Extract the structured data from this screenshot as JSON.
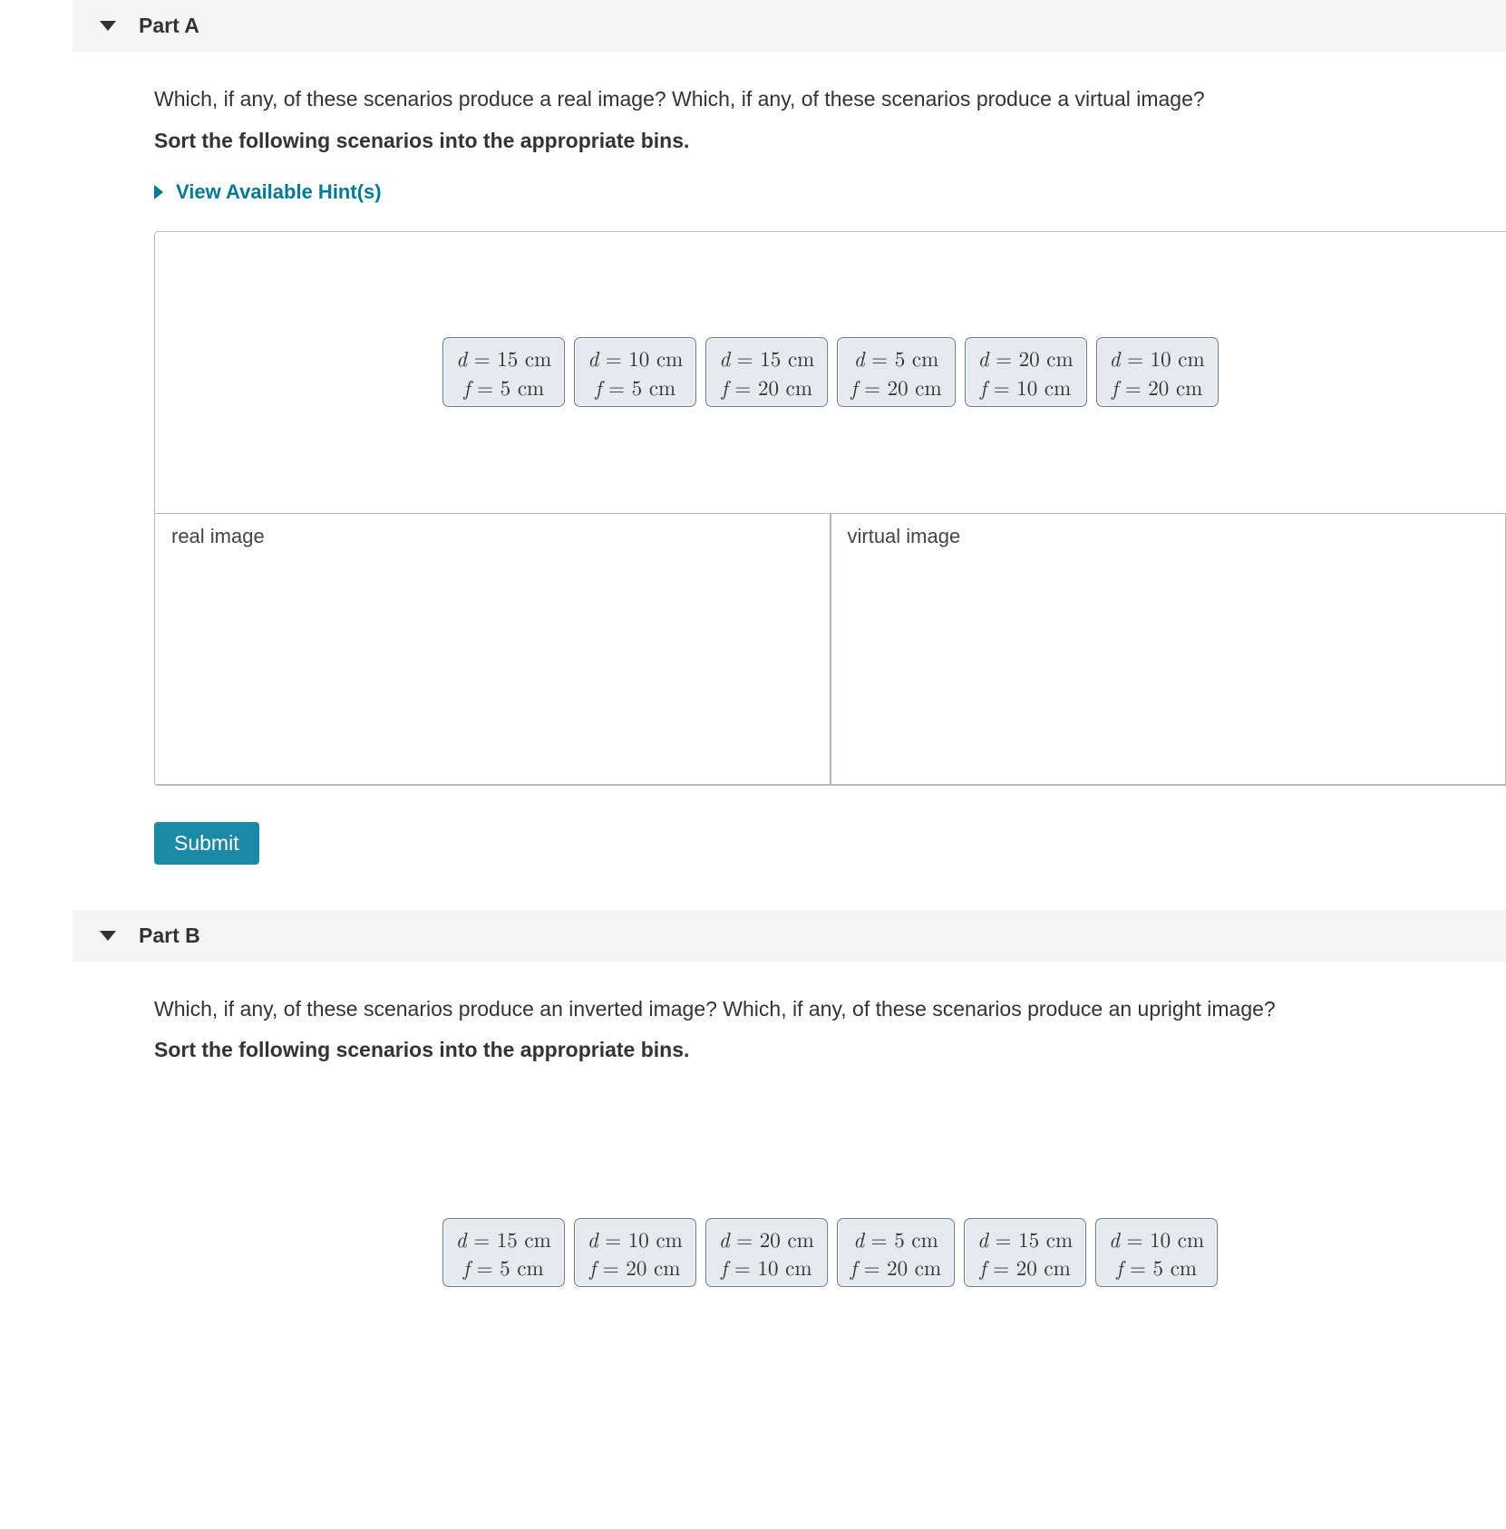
{
  "partA": {
    "title": "Part A",
    "question": "Which, if any, of these scenarios produce a real image? Which, if any, of these scenarios produce a virtual image?",
    "sort_instr": "Sort the following scenarios into the appropriate bins.",
    "hints_label": "View Available Hint(s)",
    "cards": [
      {
        "d": "15 cm",
        "f": "5 cm"
      },
      {
        "d": "10 cm",
        "f": "5 cm"
      },
      {
        "d": "15 cm",
        "f": "20 cm"
      },
      {
        "d": "5 cm",
        "f": "20 cm"
      },
      {
        "d": "20 cm",
        "f": "10 cm"
      },
      {
        "d": "10 cm",
        "f": "20 cm"
      }
    ],
    "bins": [
      "real image",
      "virtual image"
    ],
    "submit_label": "Submit"
  },
  "partB": {
    "title": "Part B",
    "question": "Which, if any, of these scenarios produce an inverted image? Which, if any, of these scenarios produce an upright image?",
    "sort_instr": "Sort the following scenarios into the appropriate bins.",
    "cards": [
      {
        "d": "15 cm",
        "f": "5 cm"
      },
      {
        "d": "10 cm",
        "f": "20 cm"
      },
      {
        "d": "20 cm",
        "f": "10 cm"
      },
      {
        "d": "5 cm",
        "f": "20 cm"
      },
      {
        "d": "15 cm",
        "f": "20 cm"
      },
      {
        "d": "10 cm",
        "f": "5 cm"
      }
    ]
  },
  "labels": {
    "d_var": "d",
    "f_var": "f",
    "eq": " = "
  }
}
